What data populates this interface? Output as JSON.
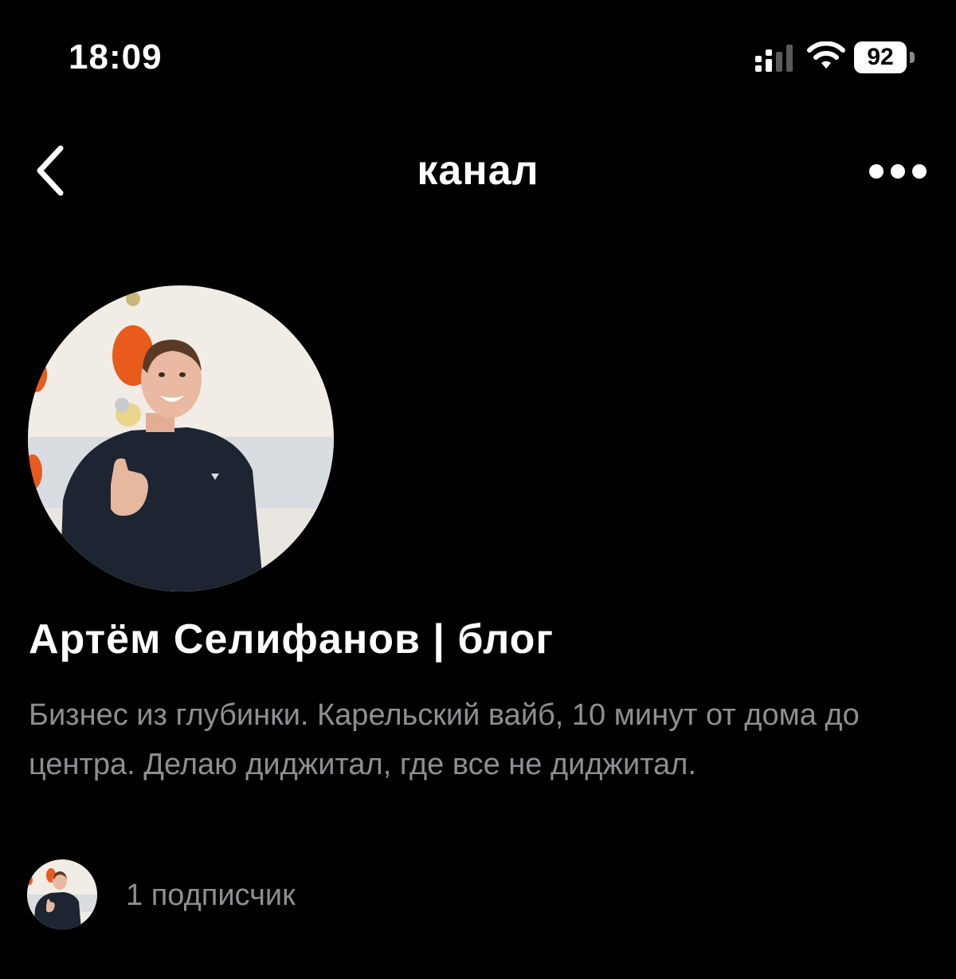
{
  "status_bar": {
    "time": "18:09",
    "battery_level": "92",
    "icons": [
      "signal-icon",
      "wifi-icon",
      "battery-icon"
    ]
  },
  "nav": {
    "title": "канал",
    "back_icon": "chevron-left-icon",
    "more_icon": "ellipsis-icon"
  },
  "channel": {
    "name": "Артём Селифанов | блог",
    "description": "Бизнес из глубинки. Карельский вайб, 10 минут от дома до центра. Делаю диджитал, где все не диджитал.",
    "subscribers_label": "1 подписчик"
  },
  "colors": {
    "background": "#000000",
    "text_primary": "#ffffff",
    "text_secondary": "#8e8e93"
  }
}
